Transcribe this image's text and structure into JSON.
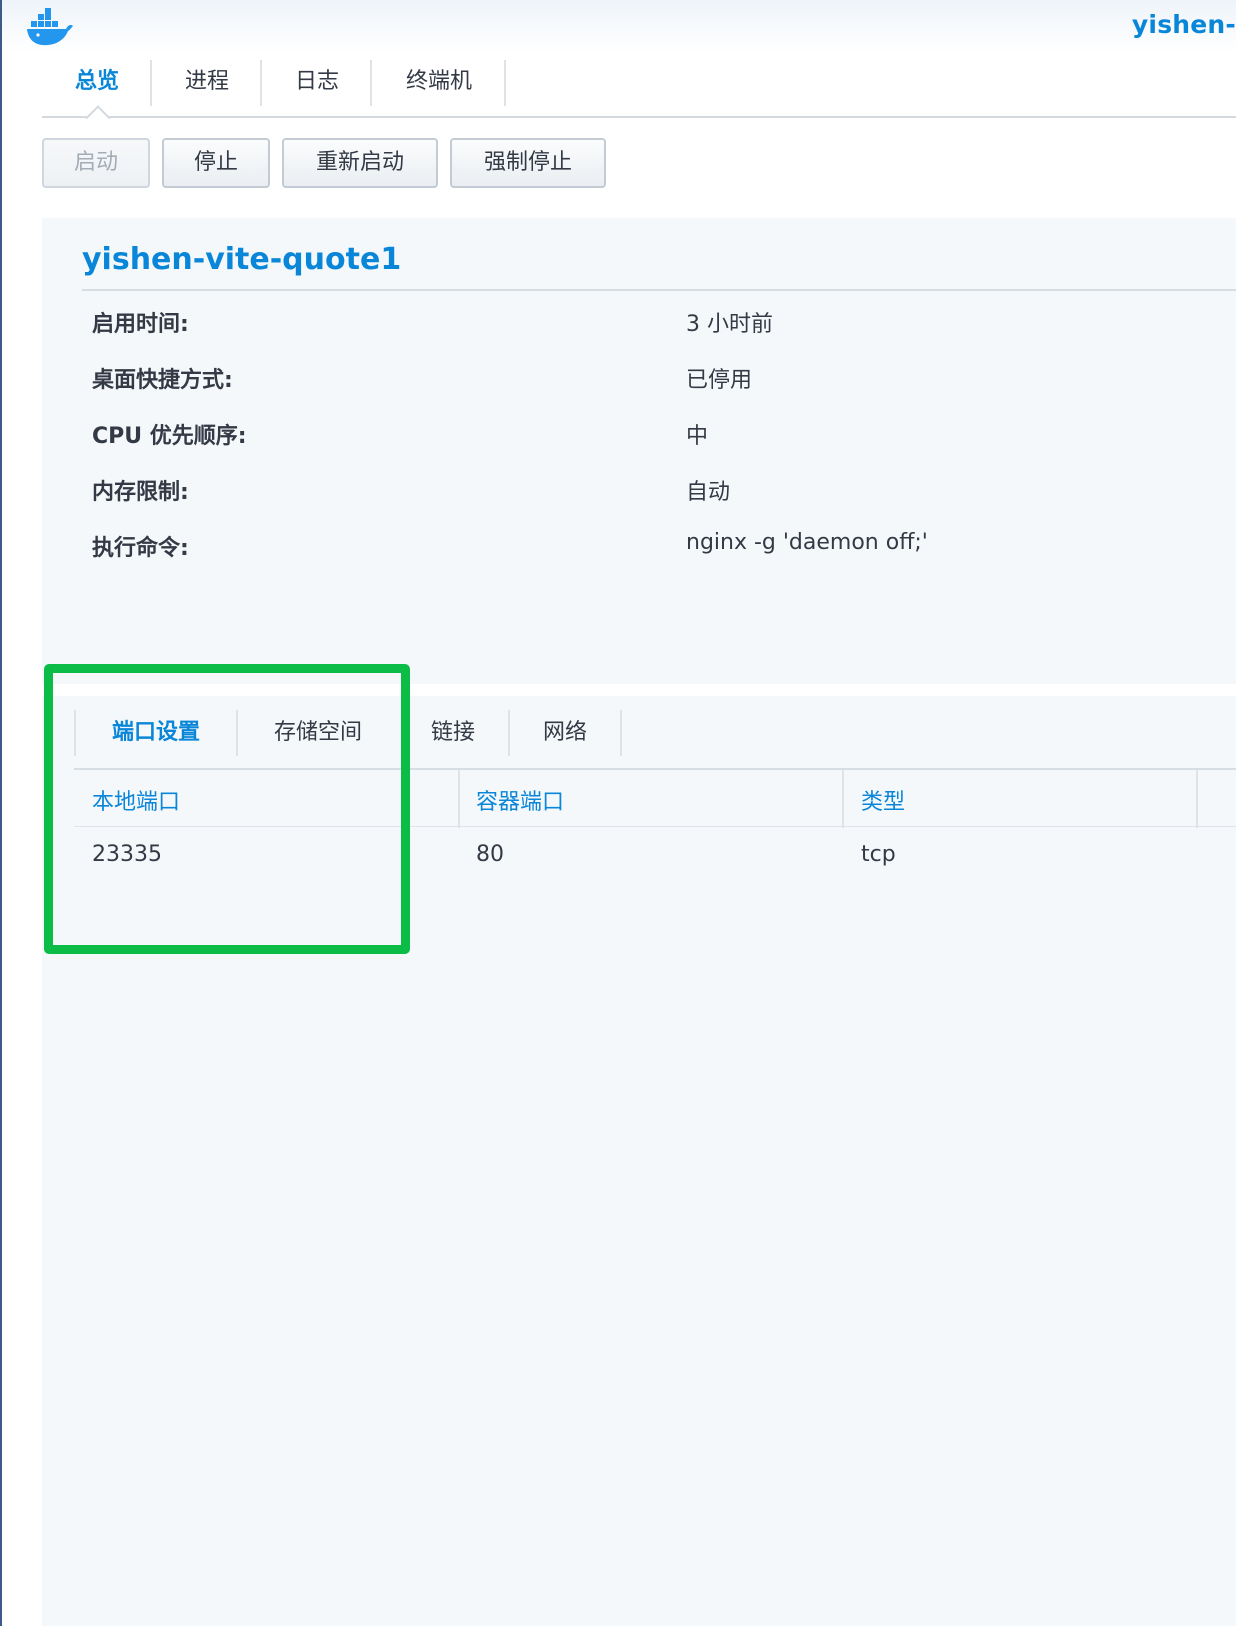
{
  "window": {
    "title": "yishen-",
    "icon": "docker-whale-icon"
  },
  "main_tabs": [
    {
      "label": "总览",
      "active": true
    },
    {
      "label": "进程",
      "active": false
    },
    {
      "label": "日志",
      "active": false
    },
    {
      "label": "终端机",
      "active": false
    }
  ],
  "toolbar": {
    "start_label": "启动",
    "start_disabled": true,
    "stop_label": "停止",
    "restart_label": "重新启动",
    "force_stop_label": "强制停止"
  },
  "container": {
    "name": "yishen-vite-quote1",
    "info": [
      {
        "label": "启用时间:",
        "value": "3 小时前"
      },
      {
        "label": "桌面快捷方式:",
        "value": "已停用"
      },
      {
        "label": "CPU 优先顺序:",
        "value": "中"
      },
      {
        "label": "内存限制:",
        "value": "自动"
      },
      {
        "label": "执行命令:",
        "value": "nginx -g 'daemon off;'"
      }
    ]
  },
  "sub_tabs": [
    {
      "label": "端口设置",
      "active": true
    },
    {
      "label": "存储空间",
      "active": false
    },
    {
      "label": "链接",
      "active": false
    },
    {
      "label": "网络",
      "active": false
    }
  ],
  "port_table": {
    "headers": [
      "本地端口",
      "容器端口",
      "类型"
    ],
    "rows": [
      [
        "23335",
        "80",
        "tcp"
      ]
    ]
  },
  "colors": {
    "accent": "#0a86d8",
    "highlight": "#0bbd47"
  }
}
